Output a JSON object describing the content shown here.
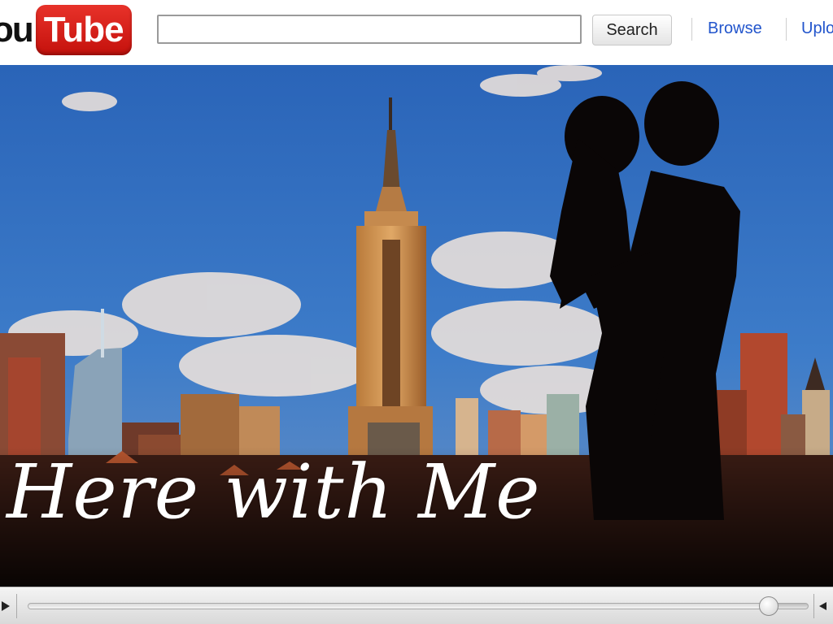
{
  "header": {
    "logo": {
      "left_text": "ou",
      "right_text": "Tube"
    },
    "search": {
      "value": "",
      "placeholder": "",
      "button_label": "Search"
    },
    "nav": [
      {
        "label": "Browse"
      },
      {
        "label": "Uplo"
      }
    ]
  },
  "video": {
    "title_overlay": "Here with Me",
    "playback_progress": 0.95
  },
  "icons": {
    "play": "play-icon",
    "volume": "volume-icon"
  },
  "colors": {
    "logo_red": "#d51f1a",
    "link_blue": "#2255cc",
    "sky": "#2f6fc2"
  }
}
